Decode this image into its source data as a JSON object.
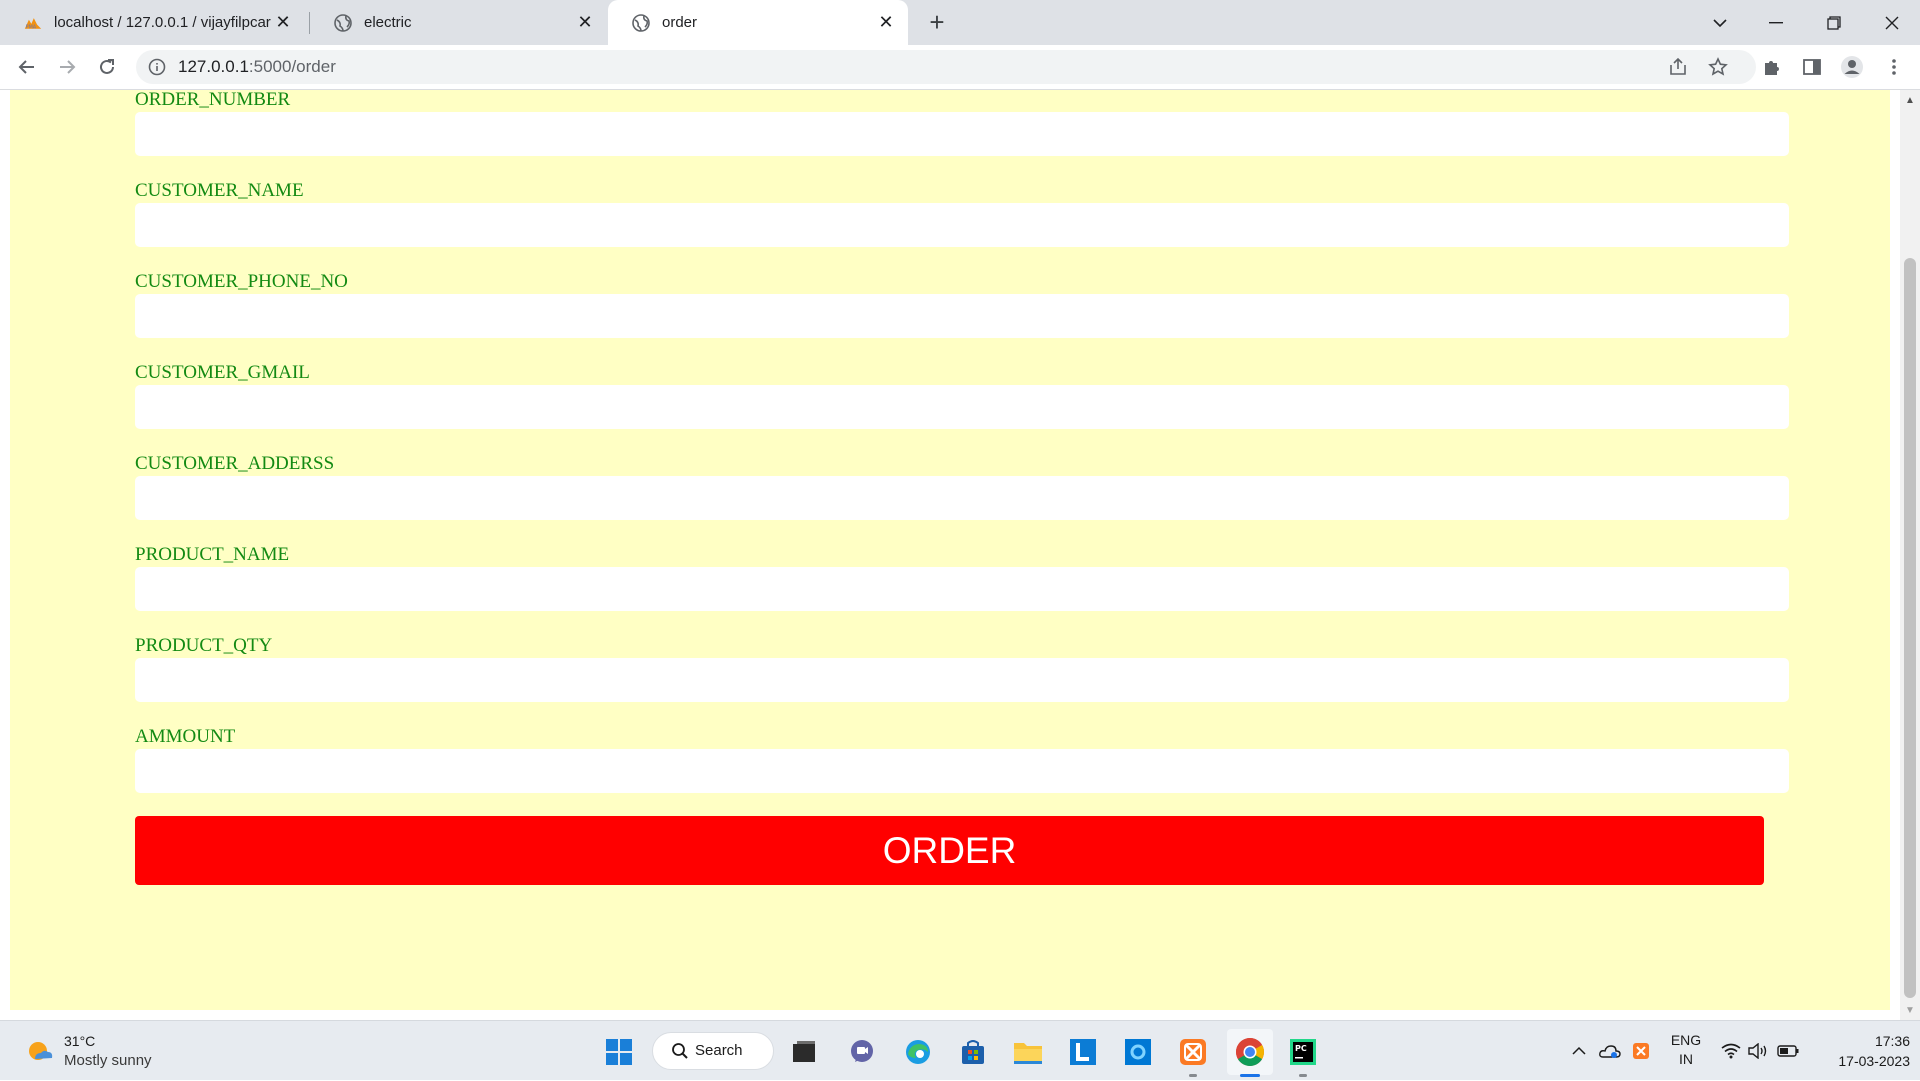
{
  "browser": {
    "tabs": [
      {
        "title": "localhost / 127.0.0.1 / vijayfilpcar",
        "active": false,
        "icon": "phpmyadmin-icon"
      },
      {
        "title": "electric",
        "active": false,
        "icon": "globe-icon"
      },
      {
        "title": "order",
        "active": true,
        "icon": "globe-icon"
      }
    ],
    "url_host": "127.0.0.1",
    "url_path": ":5000/order"
  },
  "form": {
    "fields": [
      {
        "label": "ORDER_NUMBER",
        "value": ""
      },
      {
        "label": "CUSTOMER_NAME",
        "value": ""
      },
      {
        "label": "CUSTOMER_PHONE_NO",
        "value": ""
      },
      {
        "label": "CUSTOMER_GMAIL",
        "value": ""
      },
      {
        "label": "CUSTOMER_ADDERSS",
        "value": ""
      },
      {
        "label": "PRODUCT_NAME",
        "value": ""
      },
      {
        "label": "PRODUCT_QTY",
        "value": ""
      },
      {
        "label": "AMMOUNT",
        "value": ""
      }
    ],
    "submit_label": "ORDER"
  },
  "colors": {
    "page_background": "#ffffc4",
    "label_color": "#138a13",
    "button_color": "#ff0000"
  },
  "taskbar": {
    "weather_temp": "31°C",
    "weather_desc": "Mostly sunny",
    "search_label": "Search",
    "lang_line1": "ENG",
    "lang_line2": "IN",
    "time": "17:36",
    "date": "17-03-2023"
  }
}
